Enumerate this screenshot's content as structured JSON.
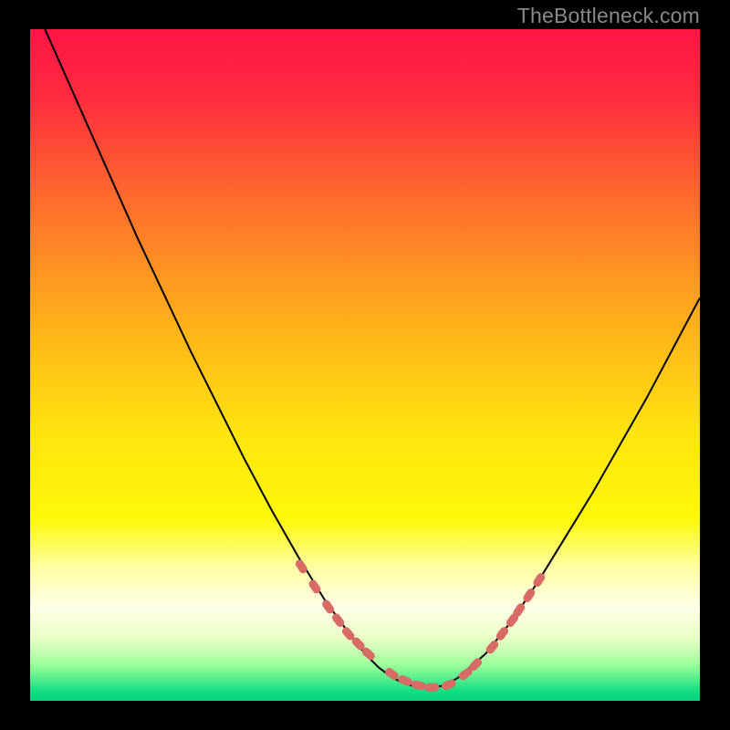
{
  "watermark": "TheBottleneck.com",
  "colors": {
    "background": "#000000",
    "gradient_stops": [
      {
        "offset": 0.0,
        "color": "#ff1546"
      },
      {
        "offset": 0.1,
        "color": "#ff2b3f"
      },
      {
        "offset": 0.25,
        "color": "#ff6a2d"
      },
      {
        "offset": 0.45,
        "color": "#ffb419"
      },
      {
        "offset": 0.6,
        "color": "#ffe40f"
      },
      {
        "offset": 0.73,
        "color": "#fff80a"
      },
      {
        "offset": 0.8,
        "color": "#fffea1"
      },
      {
        "offset": 0.86,
        "color": "#ffffe6"
      },
      {
        "offset": 0.905,
        "color": "#eaffc8"
      },
      {
        "offset": 0.925,
        "color": "#c8ffb4"
      },
      {
        "offset": 0.945,
        "color": "#a0ff9a"
      },
      {
        "offset": 0.965,
        "color": "#5cf08d"
      },
      {
        "offset": 0.985,
        "color": "#14de82"
      },
      {
        "offset": 1.0,
        "color": "#06d17e"
      }
    ],
    "curve": "#000000",
    "marker_fill": "#d86b66",
    "marker_stroke": "#d86b66"
  },
  "chart_data": {
    "type": "line",
    "title": "",
    "xlabel": "",
    "ylabel": "",
    "xlim": [
      0,
      100
    ],
    "ylim": [
      0,
      100
    ],
    "x": [
      0,
      4,
      8,
      12,
      16,
      20,
      24,
      28,
      32,
      36,
      40,
      44,
      48,
      50,
      52,
      54,
      56,
      58,
      60,
      62,
      64,
      68,
      72,
      76,
      80,
      84,
      88,
      92,
      96,
      100
    ],
    "y": [
      105,
      96,
      87,
      78,
      69,
      60.5,
      52,
      44,
      36,
      28.5,
      21.5,
      15,
      9.5,
      7,
      5,
      3.5,
      2.5,
      2,
      2,
      2.3,
      3.5,
      7,
      12,
      18,
      24.5,
      31,
      38,
      45,
      52.5,
      60
    ],
    "markers": {
      "x": [
        40.5,
        42.5,
        44.5,
        46,
        47.5,
        49,
        50.5,
        54,
        56,
        58,
        60,
        62.5,
        65,
        66.5,
        69,
        70.5,
        72,
        73,
        74.5,
        76
      ],
      "y": [
        20,
        17,
        14,
        12,
        10,
        8.5,
        7,
        4,
        3,
        2.3,
        2,
        2.4,
        4,
        5.4,
        8,
        10,
        12,
        13.5,
        15.7,
        18
      ]
    }
  }
}
